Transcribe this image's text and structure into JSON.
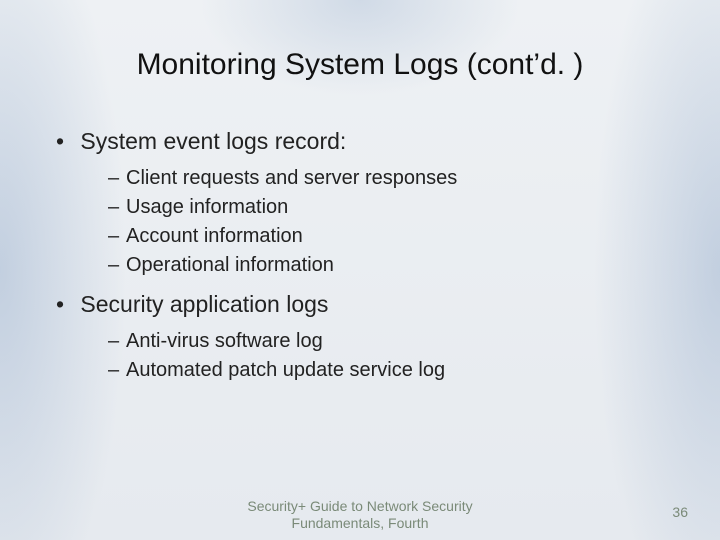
{
  "title": "Monitoring System Logs (cont’d. )",
  "bullets": [
    {
      "text": "System event logs record:",
      "sub": [
        "Client requests and server responses",
        "Usage information",
        "Account information",
        "Operational information"
      ]
    },
    {
      "text": "Security application logs",
      "sub": [
        "Anti-virus software log",
        "Automated patch update service log"
      ]
    }
  ],
  "footer": "Security+ Guide to Network Security Fundamentals, Fourth",
  "page_number": "36"
}
